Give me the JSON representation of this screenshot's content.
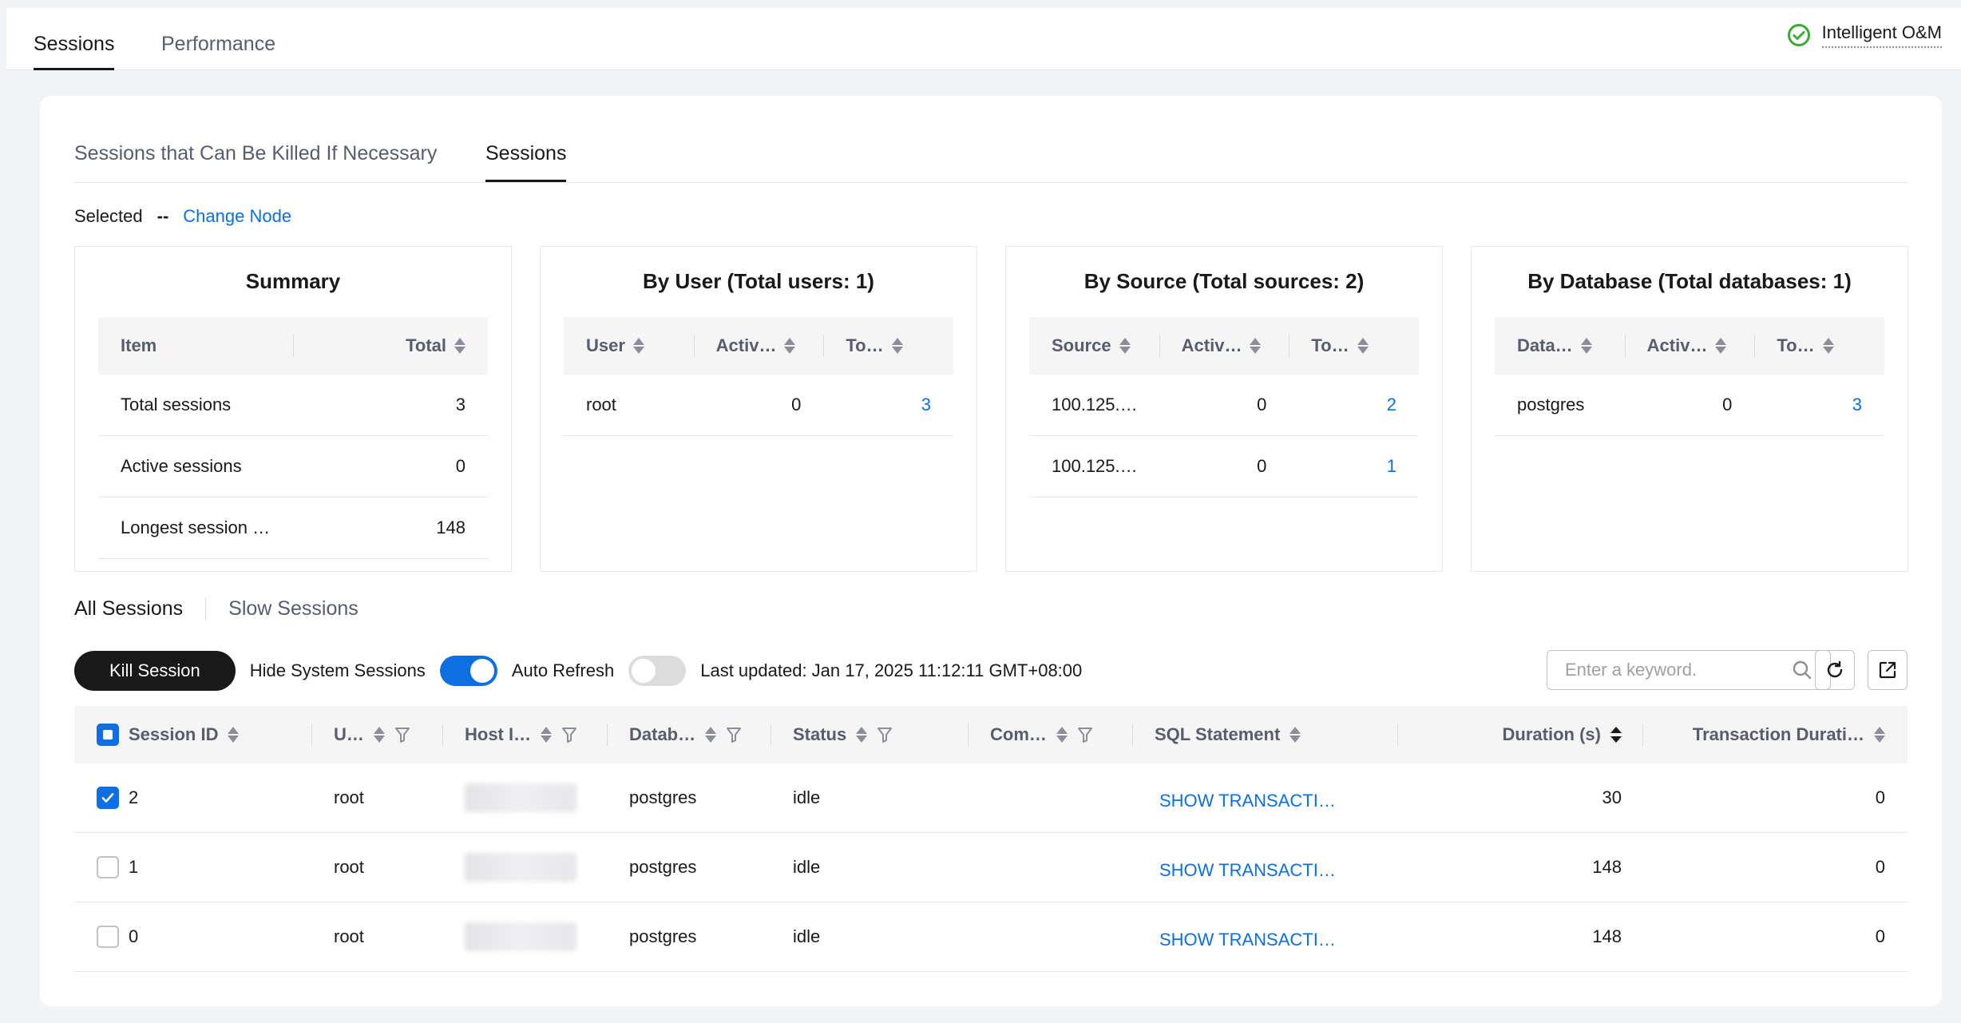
{
  "top_tabs": [
    {
      "label": "Sessions"
    },
    {
      "label": "Performance"
    }
  ],
  "intelligent_om": {
    "label": "Intelligent O&M"
  },
  "sub_tabs": [
    {
      "label": "Sessions that Can Be Killed If Necessary"
    },
    {
      "label": "Sessions"
    }
  ],
  "selected": {
    "label": "Selected",
    "value": "--",
    "change_node": "Change Node"
  },
  "summary": {
    "title": "Summary",
    "headers": [
      "Item",
      "Total"
    ],
    "rows": [
      [
        "Total sessions",
        "3"
      ],
      [
        "Active sessions",
        "0"
      ],
      [
        "Longest session …",
        "148"
      ]
    ]
  },
  "by_user": {
    "title": "By User (Total users: 1)",
    "headers": [
      "User",
      "Activ…",
      "To…"
    ],
    "rows": [
      [
        "root",
        "0",
        "3"
      ]
    ]
  },
  "by_source": {
    "title": "By Source (Total sources: 2)",
    "headers": [
      "Source",
      "Activ…",
      "To…"
    ],
    "rows": [
      [
        "100.125.…",
        "0",
        "2"
      ],
      [
        "100.125.…",
        "0",
        "1"
      ]
    ]
  },
  "by_database": {
    "title": "By Database (Total databases: 1)",
    "headers": [
      "Data…",
      "Activ…",
      "To…"
    ],
    "rows": [
      [
        "postgres",
        "0",
        "3"
      ]
    ]
  },
  "lower_tabs": [
    {
      "label": "All Sessions"
    },
    {
      "label": "Slow Sessions"
    }
  ],
  "toolbar": {
    "kill_session": "Kill Session",
    "hide_system": "Hide System Sessions",
    "hide_system_on": true,
    "auto_refresh": "Auto Refresh",
    "auto_refresh_on": false,
    "last_updated": "Last updated: Jan 17, 2025 11:12:11 GMT+08:00",
    "search_placeholder": "Enter a keyword."
  },
  "sessions_table": {
    "headers": [
      "Session ID",
      "U…",
      "Host I…",
      "Datab…",
      "Status",
      "Com…",
      "SQL Statement",
      "Duration (s)",
      "Transaction Durati…"
    ],
    "rows": [
      {
        "checked": true,
        "id": "2",
        "user": "root",
        "db": "postgres",
        "status": "idle",
        "sql": "SHOW TRANSACTI…",
        "duration": "30",
        "tduration": "0"
      },
      {
        "checked": false,
        "id": "1",
        "user": "root",
        "db": "postgres",
        "status": "idle",
        "sql": "SHOW TRANSACTI…",
        "duration": "148",
        "tduration": "0"
      },
      {
        "checked": false,
        "id": "0",
        "user": "root",
        "db": "postgres",
        "status": "idle",
        "sql": "SHOW TRANSACTI…",
        "duration": "148",
        "tduration": "0"
      }
    ]
  },
  "colors": {
    "accent": "#0d6fe0",
    "success": "#3aaa35",
    "dark": "#191919"
  }
}
